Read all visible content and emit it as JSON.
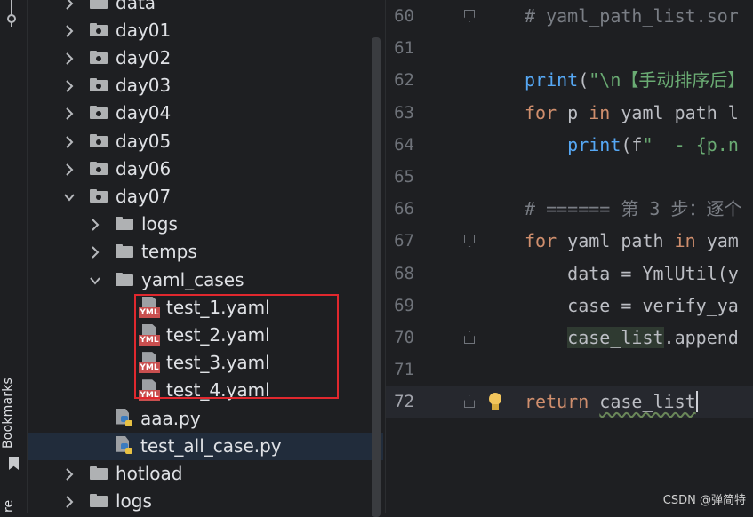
{
  "sidebar": {
    "bookmarks_label": "Bookmarks",
    "bottom_label": "re"
  },
  "tree": [
    {
      "label": "data",
      "kind": "folder",
      "depth": 0,
      "state": "collapsed"
    },
    {
      "label": "day01",
      "kind": "folder",
      "depth": 0,
      "state": "collapsed"
    },
    {
      "label": "day02",
      "kind": "folder",
      "depth": 0,
      "state": "collapsed"
    },
    {
      "label": "day03",
      "kind": "folder",
      "depth": 0,
      "state": "collapsed"
    },
    {
      "label": "day04",
      "kind": "folder",
      "depth": 0,
      "state": "collapsed"
    },
    {
      "label": "day05",
      "kind": "folder",
      "depth": 0,
      "state": "collapsed"
    },
    {
      "label": "day06",
      "kind": "folder",
      "depth": 0,
      "state": "collapsed"
    },
    {
      "label": "day07",
      "kind": "folder",
      "depth": 0,
      "state": "expanded"
    },
    {
      "label": "logs",
      "kind": "folder",
      "depth": 1,
      "state": "collapsed"
    },
    {
      "label": "temps",
      "kind": "folder",
      "depth": 1,
      "state": "collapsed"
    },
    {
      "label": "yaml_cases",
      "kind": "folder",
      "depth": 1,
      "state": "expanded"
    },
    {
      "label": "test_1.yaml",
      "kind": "yaml",
      "depth": 2
    },
    {
      "label": "test_2.yaml",
      "kind": "yaml",
      "depth": 2
    },
    {
      "label": "test_3.yaml",
      "kind": "yaml",
      "depth": 2
    },
    {
      "label": "test_4.yaml",
      "kind": "yaml",
      "depth": 2
    },
    {
      "label": "aaa.py",
      "kind": "python",
      "depth": 1
    },
    {
      "label": "test_all_case.py",
      "kind": "python",
      "depth": 1,
      "selected": true
    },
    {
      "label": "hotload",
      "kind": "folder",
      "depth": 0,
      "state": "collapsed"
    },
    {
      "label": "logs",
      "kind": "folder",
      "depth": 0,
      "state": "collapsed"
    }
  ],
  "editor": {
    "current_line": 72,
    "lines": [
      {
        "num": "60",
        "text": "# yaml_path_list.sor"
      },
      {
        "num": "61",
        "text": ""
      },
      {
        "num": "62",
        "text": "print(\"\\n【手动排序后】"
      },
      {
        "num": "63",
        "text": "for p in yaml_path_l"
      },
      {
        "num": "64",
        "text": "    print(f\"  - {p.n"
      },
      {
        "num": "65",
        "text": ""
      },
      {
        "num": "66",
        "text": "# ====== 第 3 步：逐个"
      },
      {
        "num": "67",
        "text": "for yaml_path in yam"
      },
      {
        "num": "68",
        "text": "    data = YmlUtil(y"
      },
      {
        "num": "69",
        "text": "    case = verify_ya"
      },
      {
        "num": "70",
        "text": "    case_list.append"
      },
      {
        "num": "71",
        "text": ""
      },
      {
        "num": "72",
        "text": "return case_list"
      }
    ]
  },
  "watermark": "CSDN @弹简特"
}
